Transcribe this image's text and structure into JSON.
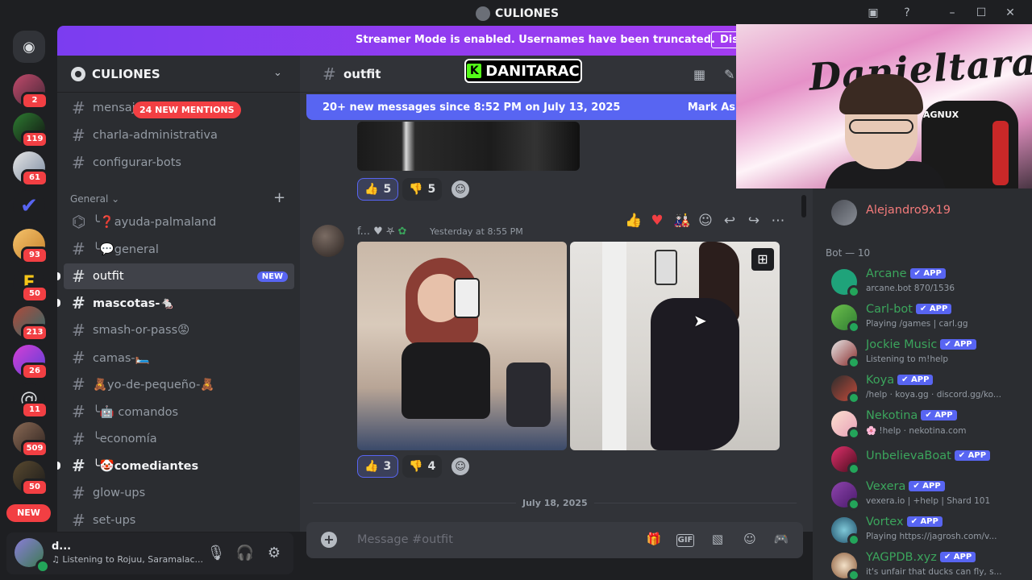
{
  "window": {
    "title": "CULIONES"
  },
  "streamer_banner": {
    "text": "Streamer Mode is enabled. Usernames have been truncated.",
    "button": "Disable"
  },
  "rail": {
    "badges": [
      "2",
      "119",
      "61",
      "93",
      "50",
      "213",
      "26",
      "11",
      "509",
      "50"
    ],
    "new_pill": "NEW"
  },
  "server": {
    "name": "CULIONES"
  },
  "mentions_pill": "24 NEW MENTIONS",
  "channels": {
    "top": [
      {
        "label": "mensaj…n-de-di…"
      },
      {
        "label": "charla-administrativa"
      },
      {
        "label": "configurar-bots"
      }
    ],
    "category": "General",
    "items": [
      {
        "label": "╰❓ayuda-palmaland"
      },
      {
        "label": "╰💬general"
      },
      {
        "label": "outfit",
        "tag": "NEW"
      },
      {
        "label": "mascotas-🐁"
      },
      {
        "label": "smash-or-pass😡"
      },
      {
        "label": "camas-🛏️"
      },
      {
        "label": "🧸yo-de-pequeño-🧸"
      },
      {
        "label": "╰🤖 comandos"
      },
      {
        "label": "╰economía"
      },
      {
        "label": "╰🤡comediantes"
      },
      {
        "label": "glow-ups"
      },
      {
        "label": "set-ups"
      }
    ]
  },
  "user_panel": {
    "name": "d...",
    "activity": "Listening to Rojuu, Saramalac..."
  },
  "chat": {
    "channel": "outfit",
    "watermark": "DANITARAC",
    "new_messages": "20+ new messages since 8:52 PM on July 13, 2025",
    "mark_as_read": "Mark As",
    "reactions_1": {
      "up": "5",
      "down": "5"
    },
    "message": {
      "user": "f...",
      "time": "Yesterday at 8:55 PM"
    },
    "reactions_2": {
      "up": "3",
      "down": "4"
    },
    "divider": "July 18, 2025",
    "placeholder": "Message #outfit"
  },
  "members": {
    "top": {
      "name": "Alejandro9x19"
    },
    "bot_header": "Bot — 10",
    "bots": [
      {
        "name": "Arcane",
        "sub": "arcane.bot 870/1536",
        "color": "#3ba55c"
      },
      {
        "name": "Carl-bot",
        "sub": "Playing /games | carl.gg",
        "color": "#3ba55c"
      },
      {
        "name": "Jockie Music",
        "sub": "Listening to m!help",
        "color": "#3ba55c"
      },
      {
        "name": "Koya",
        "sub": "/help · koya.gg · discord.gg/ko...",
        "color": "#3ba55c"
      },
      {
        "name": "Nekotina",
        "sub": "🌸 !help · nekotina.com",
        "color": "#3ba55c"
      },
      {
        "name": "UnbelievaBoat",
        "sub": "",
        "color": "#3ba55c"
      },
      {
        "name": "Vexera",
        "sub": "vexera.io | +help | Shard 101",
        "color": "#3ba55c"
      },
      {
        "name": "Vortex",
        "sub": "Playing https://jagrosh.com/v...",
        "color": "#3ba55c"
      },
      {
        "name": "YAGPDB.xyz",
        "sub": "it's unfair that ducks can fly, s...",
        "color": "#3ba55c"
      }
    ],
    "app_tag": "APP"
  },
  "webcam": {
    "graffiti": "Danieltarac",
    "label": "AGNUX"
  }
}
